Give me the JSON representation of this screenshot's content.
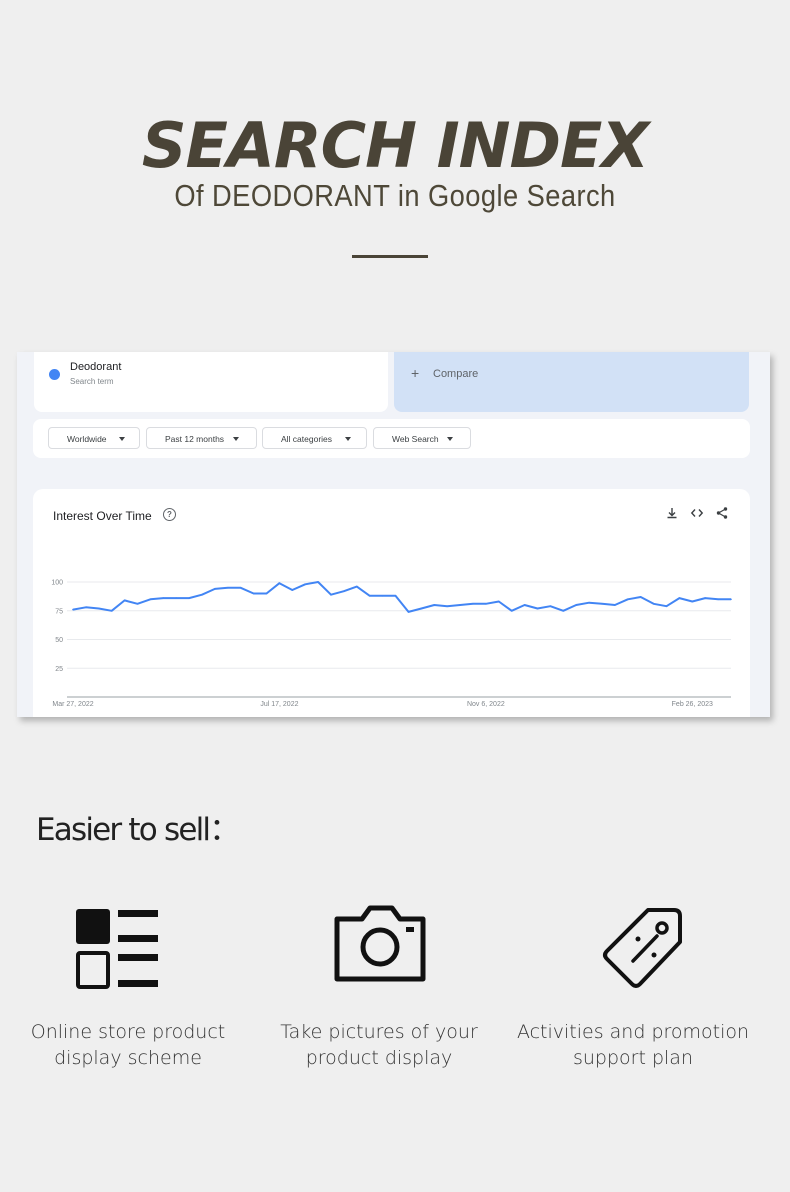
{
  "hero": {
    "title": "SEARCH INDEX",
    "subtitle": "Of  DEODORANT in Google Search"
  },
  "trends": {
    "term": {
      "name": "Deodorant",
      "sub": "Search term",
      "color": "#4285f4"
    },
    "compare": {
      "plus": "+",
      "label": "Compare"
    },
    "filters": [
      {
        "label": "Worldwide"
      },
      {
        "label": "Past 12 months"
      },
      {
        "label": "All categories"
      },
      {
        "label": "Web Search"
      }
    ],
    "chart_title": "Interest Over Time",
    "help": "?",
    "tools": [
      "download-icon",
      "embed-code-icon",
      "share-icon"
    ]
  },
  "chart_data": {
    "type": "line",
    "title": "Interest Over Time",
    "xlabel": "",
    "ylabel": "",
    "ylim": [
      0,
      100
    ],
    "yticks": [
      25,
      50,
      75,
      100
    ],
    "xtick_labels": [
      "Mar 27, 2022",
      "Jul 17, 2022",
      "Nov 6, 2022",
      "Feb 26, 2023"
    ],
    "xtick_index": [
      0,
      16,
      32,
      48
    ],
    "grid": true,
    "series": [
      {
        "color": "#4285f4",
        "values": [
          76,
          78,
          77,
          75,
          84,
          81,
          85,
          86,
          86,
          86,
          89,
          94,
          95,
          95,
          90,
          90,
          99,
          93,
          98,
          100,
          89,
          92,
          96,
          88,
          88,
          88,
          74,
          77,
          80,
          79,
          80,
          81,
          81,
          83,
          75,
          80,
          77,
          79,
          75,
          80,
          82,
          81,
          80,
          85,
          87,
          81,
          79,
          86,
          83,
          86,
          85,
          85
        ]
      }
    ]
  },
  "sell": {
    "title": "Easier to sell：",
    "features": [
      {
        "icon": "layout-grid-icon",
        "line1": "Online store product",
        "line2": "display scheme"
      },
      {
        "icon": "camera-icon",
        "line1": "Take pictures of your",
        "line2": "product display"
      },
      {
        "icon": "price-tag-icon",
        "line1": "Activities and promotion",
        "line2": "support plan"
      }
    ]
  }
}
